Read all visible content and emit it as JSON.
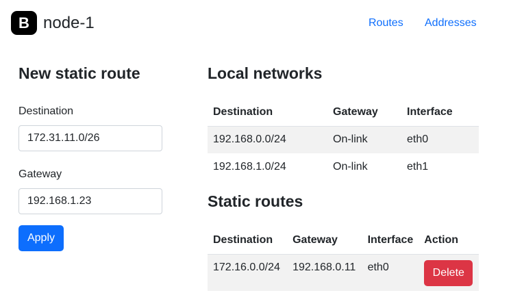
{
  "header": {
    "brand_logo_letter": "B",
    "brand_name": "node-1",
    "nav": [
      {
        "label": "Routes"
      },
      {
        "label": "Addresses"
      }
    ]
  },
  "form": {
    "title": "New static route",
    "destination_label": "Destination",
    "destination_value": "172.31.11.0/26",
    "gateway_label": "Gateway",
    "gateway_value": "192.168.1.23",
    "apply_label": "Apply"
  },
  "local_networks": {
    "title": "Local networks",
    "columns": [
      "Destination",
      "Gateway",
      "Interface"
    ],
    "rows": [
      [
        "192.168.0.0/24",
        "On-link",
        "eth0"
      ],
      [
        "192.168.1.0/24",
        "On-link",
        "eth1"
      ]
    ]
  },
  "static_routes": {
    "title": "Static routes",
    "columns": [
      "Destination",
      "Gateway",
      "Interface",
      "Action"
    ],
    "rows": [
      {
        "destination": "172.16.0.0/24",
        "gateway": "192.168.0.11",
        "interface": "eth0",
        "action_label": "Delete"
      }
    ]
  },
  "colors": {
    "primary": "#0d6efd",
    "danger": "#dc3545",
    "stripe": "#f2f2f2"
  }
}
